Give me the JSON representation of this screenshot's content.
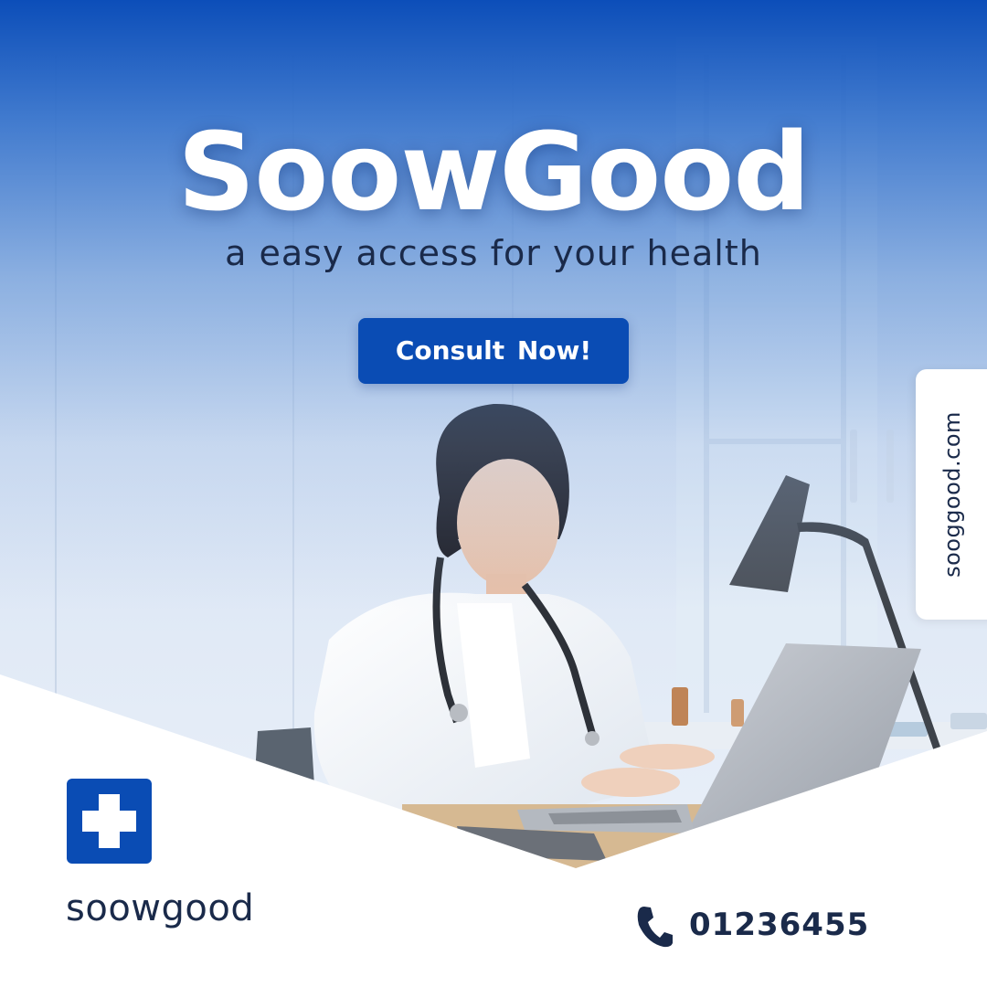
{
  "brand": {
    "title": "SoowGood",
    "tagline": "a easy access for your health",
    "wordmark": "soowgood"
  },
  "cta": {
    "label": "Consult  Now!"
  },
  "side_tab": {
    "url": "sooggood.com"
  },
  "contact": {
    "phone": "01236455"
  },
  "icons": {
    "logo": "medical-cross-icon",
    "phone": "phone-icon"
  },
  "colors": {
    "brand_blue": "#0a4cb4",
    "text_dark": "#1a2a4a",
    "white": "#ffffff"
  }
}
